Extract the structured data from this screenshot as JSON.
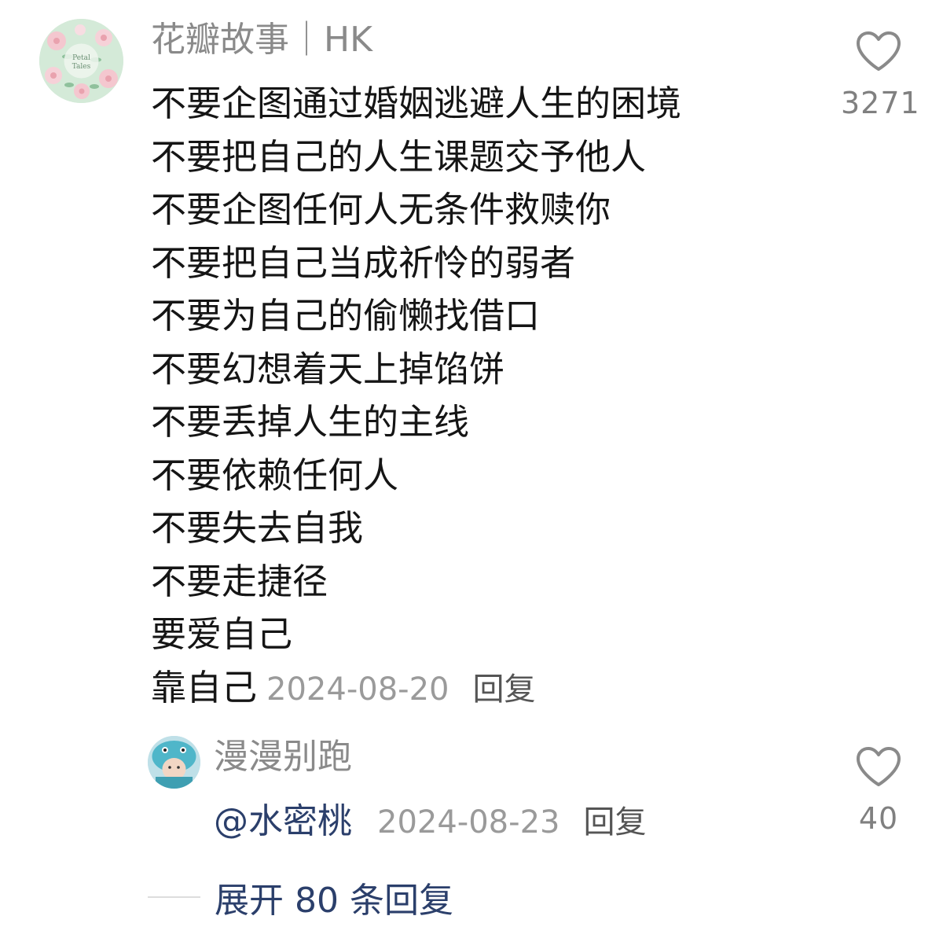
{
  "main_comment": {
    "username": "花瓣故事｜HK",
    "avatar_text": "Petal Tales",
    "lines": [
      "不要企图通过婚姻逃避人生的困境",
      "不要把自己的人生课题交予他人",
      "不要企图任何人无条件救赎你",
      "不要把自己当成祈怜的弱者",
      "不要为自己的偷懒找借口",
      "不要幻想着天上掉馅饼",
      "不要丢掉人生的主线",
      "不要依赖任何人",
      "不要失去自我",
      "不要走捷径",
      "要爱自己",
      "靠自己"
    ],
    "date": "2024-08-20",
    "reply_label": "回复",
    "like_icon": "heart-outline-icon",
    "like_count": "3271"
  },
  "reply_comment": {
    "username": "漫漫别跑",
    "mention": "@水密桃",
    "date": "2024-08-23",
    "reply_label": "回复",
    "like_icon": "heart-outline-icon",
    "like_count": "40"
  },
  "expand": {
    "label": "展开 80 条回复"
  },
  "colors": {
    "primary_text": "#151515",
    "secondary_text": "#8a8a8a",
    "link_text": "#2b3f6b",
    "icon": "#808080"
  }
}
